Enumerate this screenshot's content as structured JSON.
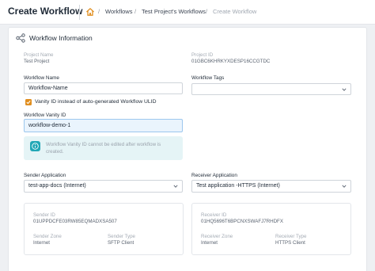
{
  "header": {
    "title": "Create Workflow",
    "breadcrumb": [
      "Workflows",
      "Test Project's Workflows",
      "Create Workflow"
    ],
    "separator": "/"
  },
  "section": {
    "title": "Workflow Information"
  },
  "project": {
    "name_label": "Project Name",
    "name_value": "Test Project",
    "id_label": "Project ID",
    "id_value": "01GBC6KHRKYXDESP16CCGTDC"
  },
  "workflow": {
    "name_label": "Workflow Name",
    "name_value": "Workflow-Name",
    "tags_label": "Workflow Tags",
    "tags_value": "",
    "vanity_checkbox_label": "Vanity ID instead of auto-generated Workflow ULID",
    "vanity_checked": true,
    "vanity_label": "Workflow Vanity ID",
    "vanity_value": "workflow-demo-1",
    "info_text": "Workflow Vanity ID cannot be edited after workflow is created."
  },
  "sender": {
    "label": "Sender Application",
    "value": "test-app-docs (Internet)",
    "id_label": "Sender ID",
    "id_value": "01UPPDCFE03RW85EQMADXSA507",
    "zone_label": "Sender Zone",
    "zone_value": "Internet",
    "type_label": "Sender Type",
    "type_value": "SFTP Client"
  },
  "receiver": {
    "label": "Receiver Application",
    "value": "Test application -HTTPS (Internet)",
    "id_label": "Receiver ID",
    "id_value": "01HQ5696T6BPCNXSWAFJ7RHDFX",
    "zone_label": "Receiver Zone",
    "zone_value": "Internet",
    "type_label": "Receiver Type",
    "type_value": "HTTPS Client"
  },
  "colors": {
    "accent_checkbox": "#e08e1f",
    "info_bg": "#e5f4f6",
    "info_icon": "#22a7b6",
    "active_input_bg": "#eaf4fd"
  },
  "icons": {
    "home": "home-icon",
    "section": "share-nodes-icon",
    "dropdown": "chevron-down-icon",
    "info": "info-icon",
    "check": "check-icon"
  }
}
